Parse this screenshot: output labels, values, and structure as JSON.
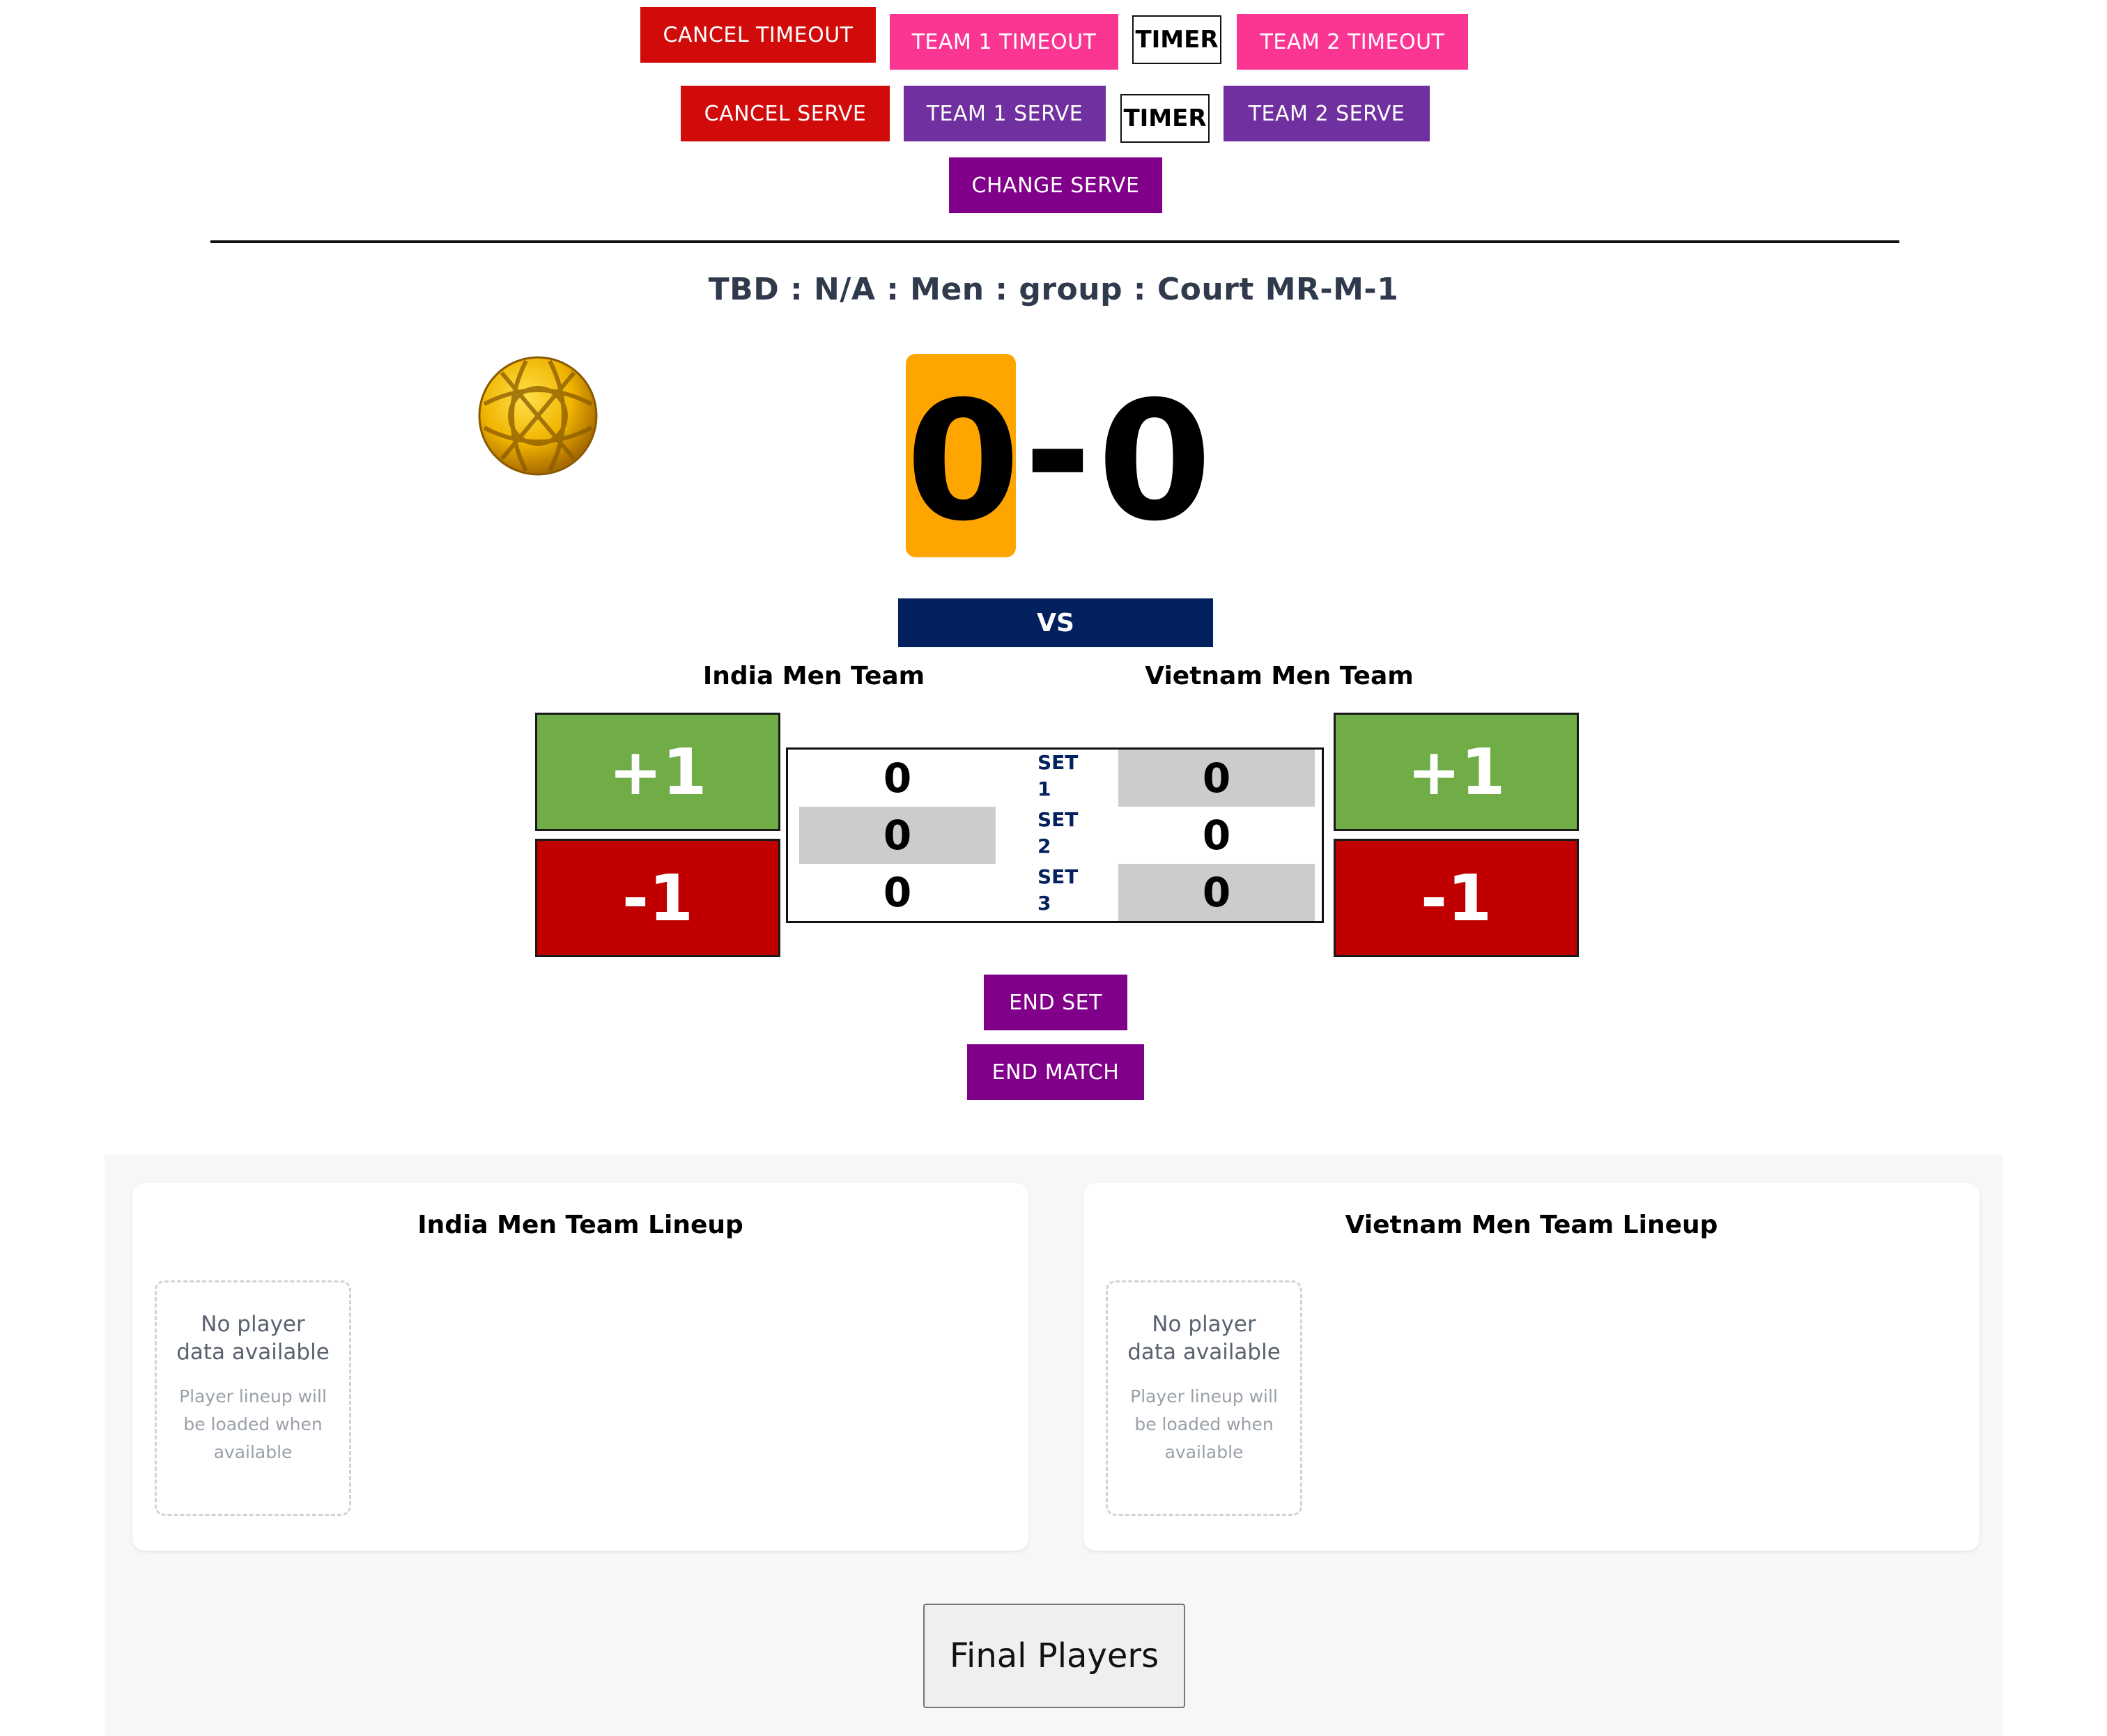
{
  "controls": {
    "cancel_timeout": "CANCEL TIMEOUT",
    "team1_timeout": "TEAM 1 TIMEOUT",
    "timer": "TIMER",
    "team2_timeout": "TEAM 2 TIMEOUT",
    "cancel_serve": "CANCEL SERVE",
    "team1_serve": "TEAM 1 SERVE",
    "team2_serve": "TEAM 2 SERVE",
    "change_serve": "CHANGE SERVE"
  },
  "match": {
    "title": "TBD : N/A : Men : group : Court MR-M-1",
    "score_team1": "0",
    "score_separator": "-",
    "score_team2": "0",
    "vs_label": "VS",
    "serving_team": 1,
    "serving_highlight_color": "#ffa500"
  },
  "teams": {
    "team1": {
      "name": "India Men Team",
      "plus": "+1",
      "minus": "-1"
    },
    "team2": {
      "name": "Vietnam Men Team",
      "plus": "+1",
      "minus": "-1"
    }
  },
  "sets": [
    {
      "label_top": "SET",
      "label_num": "1",
      "team1": "0",
      "team2": "0"
    },
    {
      "label_top": "SET",
      "label_num": "2",
      "team1": "0",
      "team2": "0"
    },
    {
      "label_top": "SET",
      "label_num": "3",
      "team1": "0",
      "team2": "0"
    }
  ],
  "actions": {
    "end_set": "END SET",
    "end_match": "END MATCH"
  },
  "lineups": {
    "team1": {
      "title": "India Men Team Lineup",
      "empty_main": "No player data available",
      "empty_sub": "Player lineup will be loaded when available"
    },
    "team2": {
      "title": "Vietnam Men Team Lineup",
      "empty_main": "No player data available",
      "empty_sub": "Player lineup will be loaded when available"
    }
  },
  "final_players": "Final Players",
  "icons": {
    "ball": "sepak-takraw-ball-icon"
  },
  "colors": {
    "red": "#d10a0a",
    "pink": "#fb3592",
    "purple": "#7030a0",
    "magenta": "#80008a",
    "navy": "#03215e",
    "green": "#70ad47",
    "dark_red": "#c00000"
  }
}
